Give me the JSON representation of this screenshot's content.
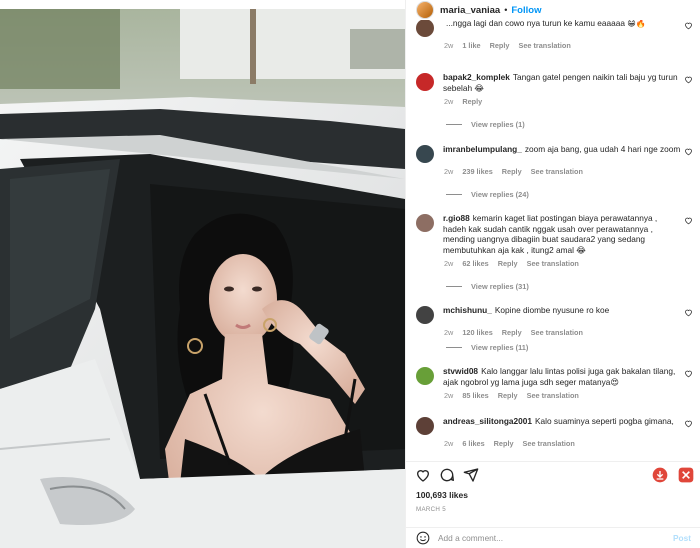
{
  "header": {
    "username": "maria_vaniaa",
    "separator": "•",
    "follow_label": "Follow"
  },
  "comments": [
    {
      "user": "",
      "text": "...ngga lagi dan cowo nya turun ke kamu eaaaaa 😁🔥",
      "time": "2w",
      "likes": "1 like",
      "reply": "Reply",
      "translation": "See translation"
    },
    {
      "user": "bapak2_komplek",
      "text": "Tangan gatel pengen naikin tali baju yg turun sebelah 😂",
      "time": "2w",
      "likes": "",
      "reply": "Reply",
      "translation": "",
      "view_replies": "View replies (1)"
    },
    {
      "user": "imranbelumpulang_",
      "text": "zoom aja bang, gua udah 4 hari nge zoom",
      "time": "2w",
      "likes": "239 likes",
      "reply": "Reply",
      "translation": "See translation",
      "view_replies": "View replies (24)"
    },
    {
      "user": "r.gio88",
      "text": "kemarin kaget liat postingan biaya perawatannya , hadeh kak sudah cantik nggak usah over perawatannya , mending uangnya dibagiin buat saudara2 yang sedang membutuhkan aja kak , itung2 amal 😂",
      "time": "2w",
      "likes": "62 likes",
      "reply": "Reply",
      "translation": "See translation",
      "view_replies": "View replies (31)"
    },
    {
      "user": "mchishunu_",
      "text": "Kopine diombe nyusune ro koe",
      "time": "2w",
      "likes": "120 likes",
      "reply": "Reply",
      "translation": "See translation",
      "view_replies": "View replies (11)"
    },
    {
      "user": "stvwid08",
      "text": "Kalo langgar lalu lintas polisi juga gak bakalan tilang, ajak ngobrol yg lama juga sdh seger matanya😍",
      "time": "2w",
      "likes": "85 likes",
      "reply": "Reply",
      "translation": "See translation"
    },
    {
      "user": "andreas_silitonga2001",
      "text": "Kalo suaminya seperti pogba gimana,",
      "time": "2w",
      "likes": "6 likes",
      "reply": "Reply",
      "translation": "See translation"
    }
  ],
  "post": {
    "likes": "100,693 likes",
    "date": "MARCH 5"
  },
  "composer": {
    "placeholder": "Add a comment...",
    "post_label": "Post"
  },
  "colors": {
    "accent": "#0095f6",
    "muted": "#8e8e8e",
    "text": "#262626",
    "app_icon": "#e0463a"
  },
  "icons": [
    "heart-icon",
    "comment-icon",
    "share-icon",
    "download-app-icon",
    "save-app-icon",
    "emoji-icon"
  ]
}
